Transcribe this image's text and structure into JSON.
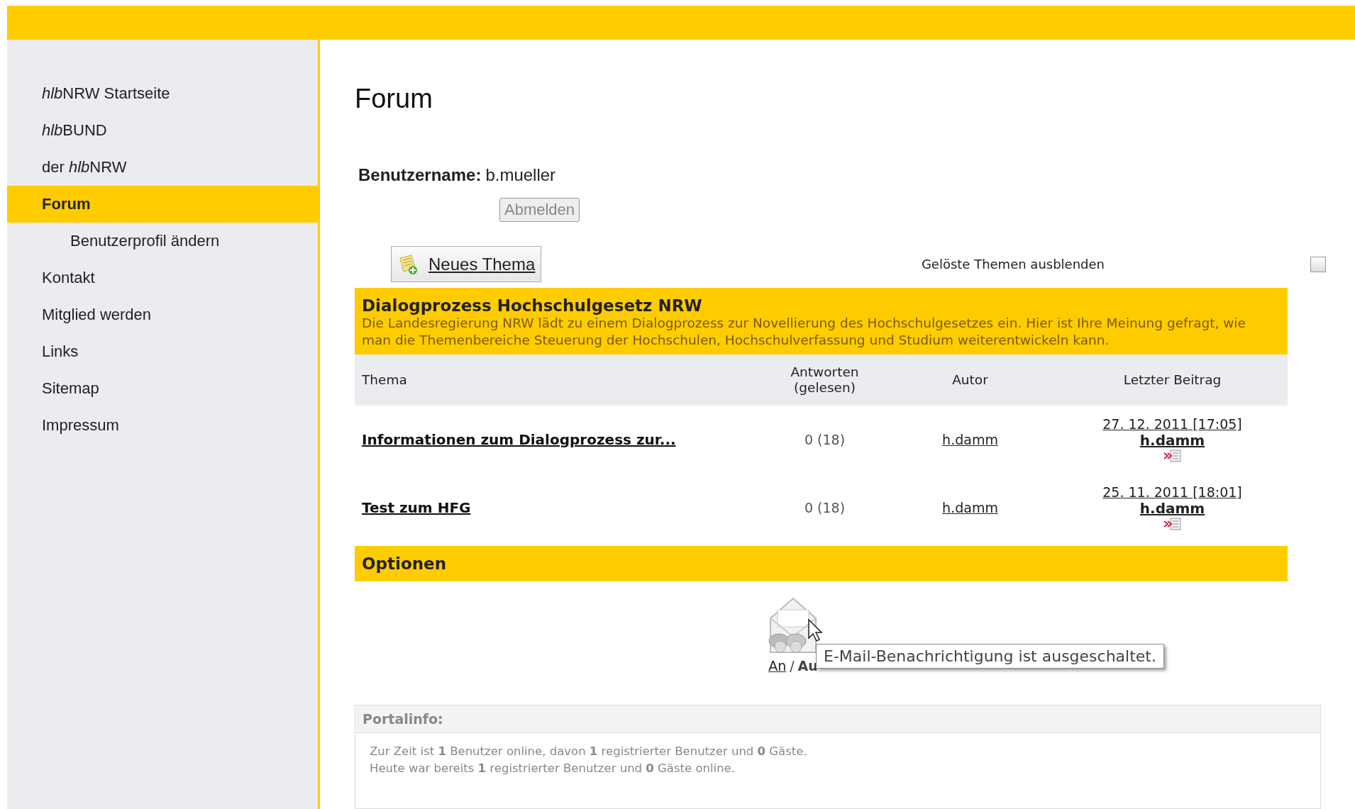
{
  "sidebar": {
    "items": [
      {
        "label_parts": [
          {
            "text": "hlb",
            "italic": true
          },
          {
            "text": "NRW Startseite",
            "italic": false
          }
        ],
        "selected": false
      },
      {
        "label_parts": [
          {
            "text": "hlb",
            "italic": true
          },
          {
            "text": "BUND",
            "italic": false
          }
        ],
        "selected": false
      },
      {
        "label_parts": [
          {
            "text": "der ",
            "italic": false
          },
          {
            "text": "hlb",
            "italic": true
          },
          {
            "text": "NRW",
            "italic": false
          }
        ],
        "selected": false
      },
      {
        "label_parts": [
          {
            "text": "Forum",
            "italic": false
          }
        ],
        "selected": true,
        "children": [
          {
            "label": "Benutzerprofil ändern",
            "selected": false
          }
        ]
      },
      {
        "label_parts": [
          {
            "text": "Kontakt",
            "italic": false
          }
        ],
        "selected": false
      },
      {
        "label_parts": [
          {
            "text": "Mitglied werden",
            "italic": false
          }
        ],
        "selected": false
      },
      {
        "label_parts": [
          {
            "text": "Links",
            "italic": false
          }
        ],
        "selected": false
      },
      {
        "label_parts": [
          {
            "text": "Sitemap",
            "italic": false
          }
        ],
        "selected": false
      },
      {
        "label_parts": [
          {
            "text": "Impressum",
            "italic": false
          }
        ],
        "selected": false
      }
    ]
  },
  "page_title": "Forum",
  "user": {
    "label": "Benutzername:",
    "value": "b.mueller",
    "logout_button": "Abmelden"
  },
  "new_topic_button": "Neues Thema",
  "hide_solved": {
    "label": "Gelöste Themen ausblenden",
    "checked": false
  },
  "forum": {
    "title": "Dialogprozess Hochschulgesetz NRW",
    "description": "Die Landesregierung NRW lädt zu einem Dialogprozess zur Novellierung des Hochschulgesetzes ein. Hier ist Ihre Meinung gefragt, wie man die Themenbereiche Steuerung der Hochschulen, Hochschulverfassung und Studium weiterentwickeln kann.",
    "columns": [
      "Thema",
      "Antworten\n(gelesen)",
      "Autor",
      "Letzter Beitrag"
    ],
    "rows": [
      {
        "topic": "Informationen zum Dialogprozess zur...",
        "replies": "0 (18)",
        "author": "h.damm",
        "last_date": "27. 12. 2011 [17:05]",
        "last_author": "h.damm"
      },
      {
        "topic": "Test zum HFG",
        "replies": "0 (18)",
        "author": "h.damm",
        "last_date": "25. 11. 2011 [18:01]",
        "last_author": "h.damm"
      }
    ]
  },
  "options": {
    "title": "Optionen",
    "on_link": "An",
    "separator": "/",
    "off_text": "Au",
    "tooltip": "E-Mail-Benachrichtigung ist ausgeschaltet."
  },
  "portal_info": {
    "title": "Portalinfo:",
    "lines": [
      "Zur Zeit ist **1** Benutzer online, davon **1** registrierter Benutzer und **0** Gäste.",
      "Heute war bereits **1** registrierter Benutzer und **0** Gäste online."
    ]
  }
}
